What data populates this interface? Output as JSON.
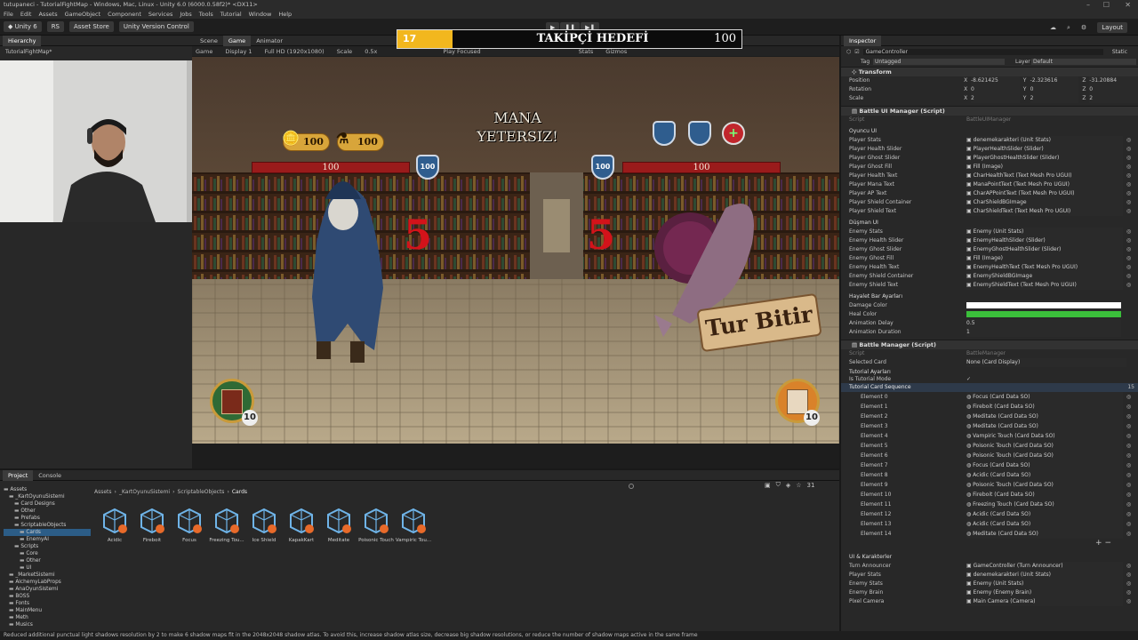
{
  "titlebar": {
    "title": "tutupaneci - TutorialFightMap - Windows, Mac, Linux - Unity 6.0 (6000.0.58f2)* <DX11>"
  },
  "menu": [
    "File",
    "Edit",
    "Assets",
    "GameObject",
    "Component",
    "Services",
    "Jobs",
    "Tools",
    "Tutorial",
    "Window",
    "Help"
  ],
  "toolbar": {
    "account": "Unity 6",
    "rs": "RS",
    "asset_store": "Asset Store",
    "version_control": "Unity Version Control",
    "layout": "Layout"
  },
  "hierarchy": {
    "tab": "Hierarchy",
    "root": "TutorialFightMap*"
  },
  "scene": {
    "tabs": [
      "Scene",
      "Game",
      "Animator"
    ],
    "gamebar": [
      "Game",
      "Display 1",
      "Full HD (1920x1080)",
      "Scale",
      "0.5x",
      "Play Focused",
      "Stats",
      "Gizmos"
    ]
  },
  "quest": {
    "count": "17",
    "title": "TAKİPÇİ HEDEFİ",
    "target": "100"
  },
  "game": {
    "mana_warning": "MANA YETERSIZ!",
    "player_gold": "100",
    "player_potion": "100",
    "player_hp": "100",
    "player_shield": "100",
    "enemy_hp": "100",
    "enemy_shield": "100",
    "player_dmg": "5",
    "enemy_dmg": "5",
    "end_turn": "Tur Bitir",
    "deck_count": "10",
    "discard_count": "10"
  },
  "inspector": {
    "tab": "Inspector",
    "object": "GameController",
    "static": "Static",
    "tag_label": "Tag",
    "tag": "Untagged",
    "layer_label": "Layer",
    "layer": "Default",
    "transform": {
      "title": "Transform",
      "position": [
        "Position",
        "X",
        "-8.621425",
        "Y",
        "-2.323616",
        "Z",
        "-31.20884"
      ],
      "rotation": [
        "Rotation",
        "X",
        "0",
        "Y",
        "0",
        "Z",
        "0"
      ],
      "scale": [
        "Scale",
        "X",
        "2",
        "Y",
        "2",
        "Z",
        "2"
      ]
    },
    "battle_ui": {
      "title": "Battle UI Manager (Script)",
      "script_label": "Script",
      "script": "BattleUIManager",
      "player_section": "Oyuncu UI",
      "player_rows": [
        [
          "Player Stats",
          "denemekarakteri (Unit Stats)"
        ],
        [
          "Player Health Slider",
          "PlayerHealthSlider (Slider)"
        ],
        [
          "Player Ghost Slider",
          "PlayerGhostHealthSlider (Slider)"
        ],
        [
          "Player Ghost Fill",
          "Fill (Image)"
        ],
        [
          "Player Health Text",
          "CharHealthText (Text Mesh Pro UGUI)"
        ],
        [
          "Player Mana Text",
          "ManaPointText (Text Mesh Pro UGUI)"
        ],
        [
          "Player AP Text",
          "CharAPPointText (Text Mesh Pro UGUI)"
        ],
        [
          "Player Shield Container",
          "CharShieldBGImage"
        ],
        [
          "Player Shield Text",
          "CharShieldText (Text Mesh Pro UGUI)"
        ]
      ],
      "enemy_section": "Düşman UI",
      "enemy_rows": [
        [
          "Enemy Stats",
          "Enemy (Unit Stats)"
        ],
        [
          "Enemy Health Slider",
          "EnemyHealthSlider (Slider)"
        ],
        [
          "Enemy Ghost Slider",
          "EnemyGhostHealthSlider (Slider)"
        ],
        [
          "Enemy Ghost Fill",
          "Fill (Image)"
        ],
        [
          "Enemy Health Text",
          "EnemyHealthText (Text Mesh Pro UGUI)"
        ],
        [
          "Enemy Shield Container",
          "EnemyShieldBGImage"
        ],
        [
          "Enemy Shield Text",
          "EnemyShieldText (Text Mesh Pro UGUI)"
        ]
      ],
      "ghost_section": "Hayalet Bar Ayarları",
      "damage_color": "Damage Color",
      "heal_color": "Heal Color",
      "anim_delay": "Animation Delay",
      "anim_delay_val": "0.5",
      "anim_duration": "Animation Duration",
      "anim_duration_val": "1",
      "colors": {
        "damage": "#ffffff",
        "heal": "#3bbf3b"
      }
    },
    "battle_mgr": {
      "title": "Battle Manager (Script)",
      "script_label": "Script",
      "script": "BattleManager",
      "selected_card": "Selected Card",
      "selected_card_val": "None (Card Display)",
      "tutorial_section": "Tutorial Ayarları",
      "is_tutorial": "Is Tutorial Mode",
      "sequence": "Tutorial Card Sequence",
      "sequence_count": "15",
      "elements": [
        [
          "Element 0",
          "Focus (Card Data SO)"
        ],
        [
          "Element 1",
          "Fireboit (Card Data SO)"
        ],
        [
          "Element 2",
          "Meditate (Card Data SO)"
        ],
        [
          "Element 3",
          "Meditate (Card Data SO)"
        ],
        [
          "Element 4",
          "Vampiric Touch (Card Data SO)"
        ],
        [
          "Element 5",
          "Poisonic Touch (Card Data SO)"
        ],
        [
          "Element 6",
          "Poisonic Touch (Card Data SO)"
        ],
        [
          "Element 7",
          "Focus (Card Data SO)"
        ],
        [
          "Element 8",
          "Acidic (Card Data SO)"
        ],
        [
          "Element 9",
          "Poisonic Touch (Card Data SO)"
        ],
        [
          "Element 10",
          "Fireboit (Card Data SO)"
        ],
        [
          "Element 11",
          "Freezing Touch (Card Data SO)"
        ],
        [
          "Element 12",
          "Acidic (Card Data SO)"
        ],
        [
          "Element 13",
          "Acidic (Card Data SO)"
        ],
        [
          "Element 14",
          "Meditate (Card Data SO)"
        ]
      ],
      "ui_section": "UI & Karakterler",
      "ui_rows": [
        [
          "Turn Announcer",
          "GameController (Turn Announcer)"
        ],
        [
          "Player Stats",
          "denemekarakteri (Unit Stats)"
        ],
        [
          "Enemy Stats",
          "Enemy (Unit Stats)"
        ],
        [
          "Enemy Brain",
          "Enemy (Enemy Brain)"
        ],
        [
          "Pixel Camera",
          "Main Camera (Camera)"
        ]
      ]
    }
  },
  "project": {
    "tabs": [
      "Project",
      "Console"
    ],
    "breadcrumb": [
      "Assets",
      "_KartOyunuSistemi",
      "ScriptableObjects",
      "Cards"
    ],
    "tree": [
      "Assets",
      "_KartOyunuSistemi",
      "Card Designs",
      "Other",
      "Prefabs",
      "ScriptableObjects",
      "Cards",
      "EnemyAI",
      "Scripts",
      "Core",
      "Other",
      "UI",
      "_MarketSistemi",
      "AlchemyLabProps",
      "AnaOyunSistemi",
      "BOSS",
      "Fonts",
      "MainMenu",
      "Meth",
      "Musics"
    ],
    "assets": [
      "Acidic",
      "Fireboit",
      "Focus",
      "Freezing Tou...",
      "Ice Shield",
      "KapakKart",
      "Meditate",
      "Poisonic Touch",
      "Vampiric Tou..."
    ],
    "count": "31"
  },
  "status": "Reduced additional punctual light shadows resolution by 2 to make 6 shadow maps fit in the 2048x2048 shadow atlas. To avoid this, increase shadow atlas size, decrease big shadow resolutions, or reduce the number of shadow maps active in the same frame"
}
